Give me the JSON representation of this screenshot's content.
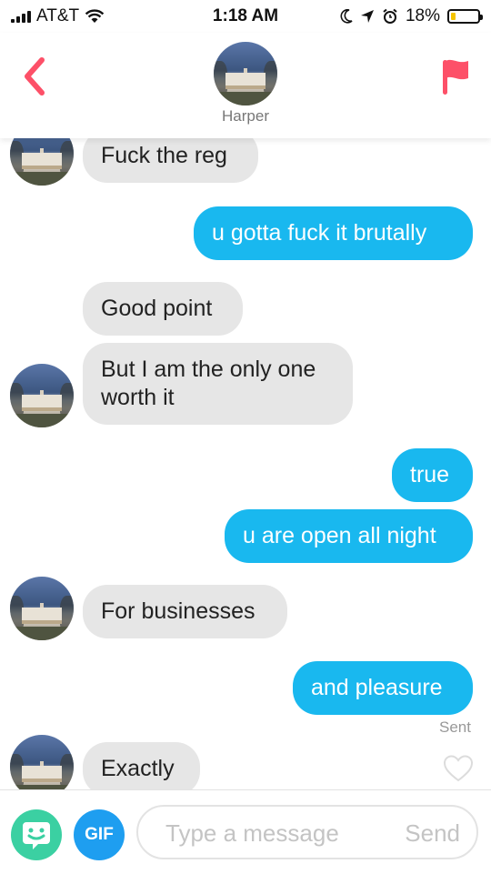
{
  "status_bar": {
    "carrier": "AT&T",
    "time": "1:18 AM",
    "battery": "18%",
    "battery_level": 0.18,
    "battery_color": "#f5c400"
  },
  "header": {
    "contact_name": "Harper",
    "back_icon": "chevron-left-icon",
    "report_icon": "flag-icon",
    "accent_color": "#fd5068"
  },
  "messages": [
    {
      "direction": "incoming",
      "text": "Fuck the reg"
    },
    {
      "direction": "outgoing",
      "text": "u gotta fuck it brutally"
    },
    {
      "direction": "incoming",
      "text": "Good point"
    },
    {
      "direction": "incoming",
      "text": "But I am the only one worth it"
    },
    {
      "direction": "outgoing",
      "text": "true"
    },
    {
      "direction": "outgoing",
      "text": "u are open all night"
    },
    {
      "direction": "incoming",
      "text": "For businesses"
    },
    {
      "direction": "outgoing",
      "text": "and pleasure"
    },
    {
      "direction": "incoming",
      "text": "Exactly"
    }
  ],
  "delivery_status": "Sent",
  "composer": {
    "gif_label": "GIF",
    "placeholder": "Type a message",
    "send_label": "Send"
  },
  "colors": {
    "outgoing_bubble": "#19b8ef",
    "incoming_bubble": "#e6e6e6"
  }
}
